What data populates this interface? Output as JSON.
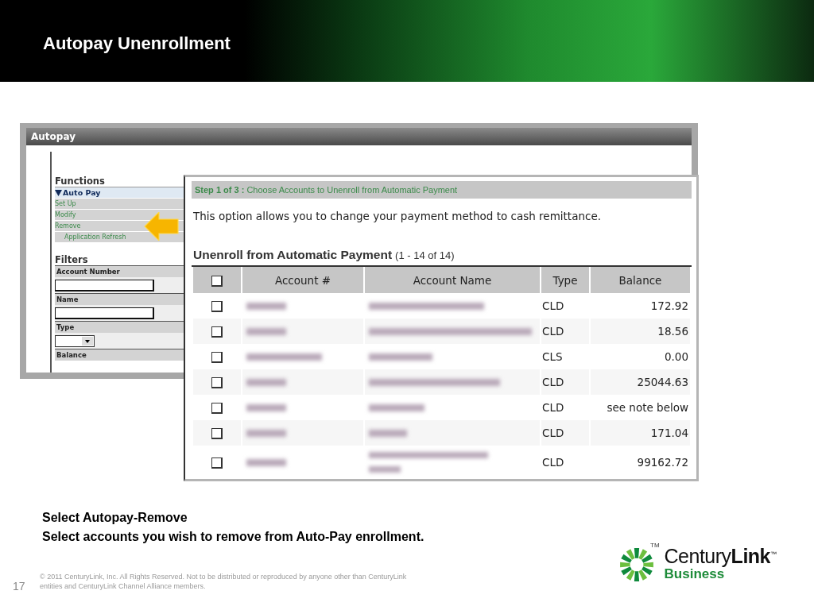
{
  "slide": {
    "title": "Autopay Unenrollment",
    "page_number": "17"
  },
  "app": {
    "header": "Autopay",
    "sidebar": {
      "functions_heading": "Functions",
      "group": {
        "label": "Auto Pay",
        "expanded": true
      },
      "items": [
        {
          "label": "Set Up",
          "indented": false
        },
        {
          "label": "Modify",
          "indented": false
        },
        {
          "label": "Remove",
          "indented": false
        },
        {
          "label": "Application Refresh",
          "indented": true
        }
      ],
      "filters_heading": "Filters",
      "filters": [
        {
          "label": "Account Number",
          "kind": "text"
        },
        {
          "label": "Name",
          "kind": "text"
        },
        {
          "label": "Type",
          "kind": "select"
        },
        {
          "label": "Balance",
          "kind": "none"
        }
      ]
    },
    "step": {
      "prefix": "Step 1 of 3 :",
      "text": "Choose Accounts to Unenroll from Automatic Payment"
    },
    "intro": "This option allows you to change your payment method to cash remittance.",
    "table_title": "Unenroll from Automatic Payment",
    "table_count": "(1 - 14 of 14)",
    "table": {
      "select_all_checked": false,
      "columns": [
        "Account #",
        "Account Name",
        "Type",
        "Balance"
      ],
      "rows": [
        {
          "checked": false,
          "type": "CLD",
          "balance": "172.92"
        },
        {
          "checked": false,
          "type": "CLD",
          "balance": "18.56"
        },
        {
          "checked": false,
          "type": "CLS",
          "balance": "0.00"
        },
        {
          "checked": false,
          "type": "CLD",
          "balance": "25044.63"
        },
        {
          "checked": false,
          "type": "CLD",
          "balance": "see note below"
        },
        {
          "checked": false,
          "type": "CLD",
          "balance": "171.04"
        },
        {
          "checked": false,
          "type": "CLD",
          "balance": "99162.72"
        }
      ]
    }
  },
  "instructions": [
    "Select Autopay-Remove",
    "Select accounts you wish to remove from Auto-Pay enrollment."
  ],
  "footer": {
    "copyright": "© 2011 CenturyLink, Inc. All Rights Reserved. Not to be distributed or reproduced by anyone other than CenturyLink entities and CenturyLink Channel Alliance members."
  },
  "logo": {
    "name_light": "Century",
    "name_bold": "Link",
    "trademark": "™",
    "mark_trademark": "TM",
    "sub": "Business"
  }
}
